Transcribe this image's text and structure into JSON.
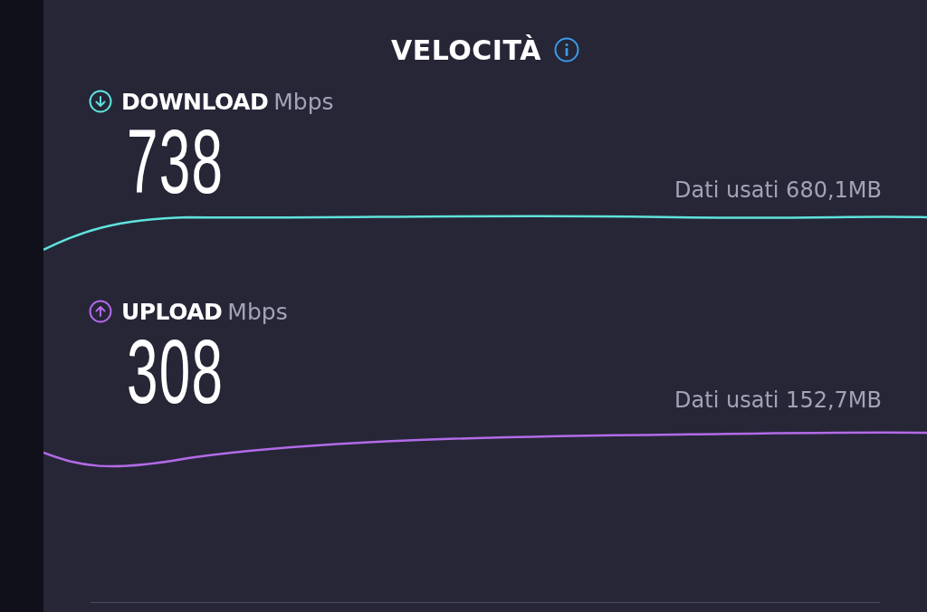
{
  "title": "VELOCITÀ",
  "metrics": [
    {
      "kind": "download",
      "label": "DOWNLOAD",
      "unit": "Mbps",
      "value": "738",
      "data_used": "Dati usati 680,1MB"
    },
    {
      "kind": "upload",
      "label": "UPLOAD",
      "unit": "Mbps",
      "value": "308",
      "data_used": "Dati usati 152,7MB"
    }
  ]
}
